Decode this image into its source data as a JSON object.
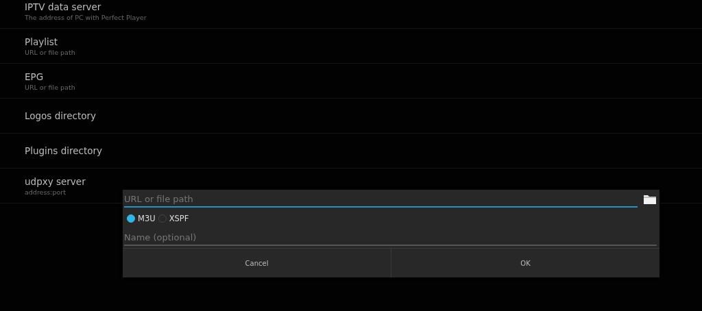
{
  "settings": [
    {
      "title": "IPTV data server",
      "subtitle": "The address of PC with Perfect Player"
    },
    {
      "title": "Playlist",
      "subtitle": "URL or file path"
    },
    {
      "title": "EPG",
      "subtitle": "URL or file path"
    },
    {
      "title": "Logos directory"
    },
    {
      "title": "Plugins directory"
    },
    {
      "title": "udpxy server",
      "subtitle": "address:port"
    }
  ],
  "dialog": {
    "url_field": {
      "placeholder": "URL or file path",
      "focused": true
    },
    "formats": [
      {
        "label": "M3U",
        "selected": true
      },
      {
        "label": "XSPF",
        "selected": false
      }
    ],
    "name_field": {
      "placeholder": "Name (optional)"
    },
    "buttons": [
      "Cancel",
      "OK"
    ]
  }
}
